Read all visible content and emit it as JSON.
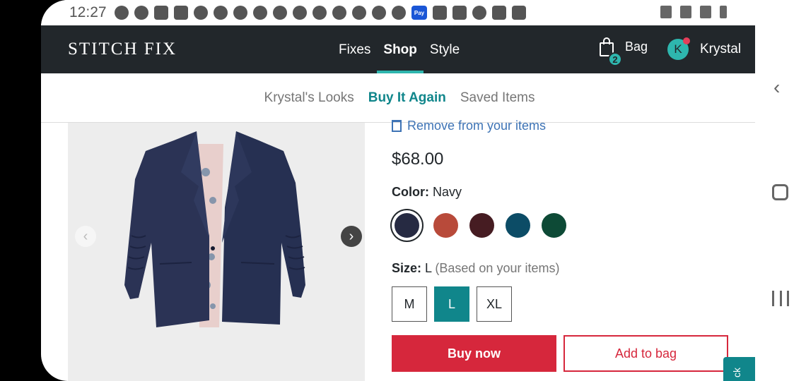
{
  "status_bar": {
    "time": "12:27",
    "left_icons": [
      "messenger-icon",
      "pinterest-icon",
      "youtube-icon",
      "youtube-icon",
      "chrome-icon",
      "chrome-icon",
      "chrome-icon",
      "chrome-icon",
      "chrome-icon",
      "chrome-icon",
      "chrome-icon",
      "tag-icon",
      "chrome-icon",
      "chrome-icon",
      "google-icon",
      "pay-icon",
      "amazon-icon",
      "zillow-icon",
      "pinterest-icon",
      "shopping-bag-icon",
      "check-icon"
    ],
    "right_icons": [
      "mute-icon",
      "data-icon",
      "signal-icon",
      "battery-icon"
    ],
    "pay_label": "Pay"
  },
  "header": {
    "logo": "STITCH FIX",
    "nav": [
      {
        "label": "Fixes",
        "active": false
      },
      {
        "label": "Shop",
        "active": true
      },
      {
        "label": "Style",
        "active": false
      }
    ],
    "bag": {
      "label": "Bag",
      "count": "2"
    },
    "user": {
      "initial": "K",
      "name": "Krystal"
    }
  },
  "subnav": [
    {
      "label": "Krystal's Looks",
      "active": false
    },
    {
      "label": "Buy It Again",
      "active": true
    },
    {
      "label": "Saved Items",
      "active": false
    }
  ],
  "product": {
    "remove_link": "Remove from your items",
    "price": "$68.00",
    "color_label": "Color:",
    "color_value": "Navy",
    "swatches": [
      {
        "name": "navy",
        "color": "#262a42",
        "selected": true
      },
      {
        "name": "rust",
        "color": "#b84a3a",
        "selected": false
      },
      {
        "name": "burgundy",
        "color": "#461c22",
        "selected": false
      },
      {
        "name": "teal",
        "color": "#0c4c66",
        "selected": false
      },
      {
        "name": "green",
        "color": "#0d4a36",
        "selected": false
      }
    ],
    "size_label": "Size:",
    "size_value": "L",
    "size_note": "(Based on your items)",
    "sizes": [
      {
        "label": "M",
        "selected": false
      },
      {
        "label": "L",
        "selected": true
      },
      {
        "label": "XL",
        "selected": false
      }
    ],
    "buy_now": "Buy now",
    "add_to_bag": "Add to bag",
    "feedback": "ck"
  },
  "colors": {
    "header_bg": "#22272b",
    "accent_teal": "#10868b",
    "brand_red": "#d6273c",
    "link_blue": "#3d73b5"
  }
}
